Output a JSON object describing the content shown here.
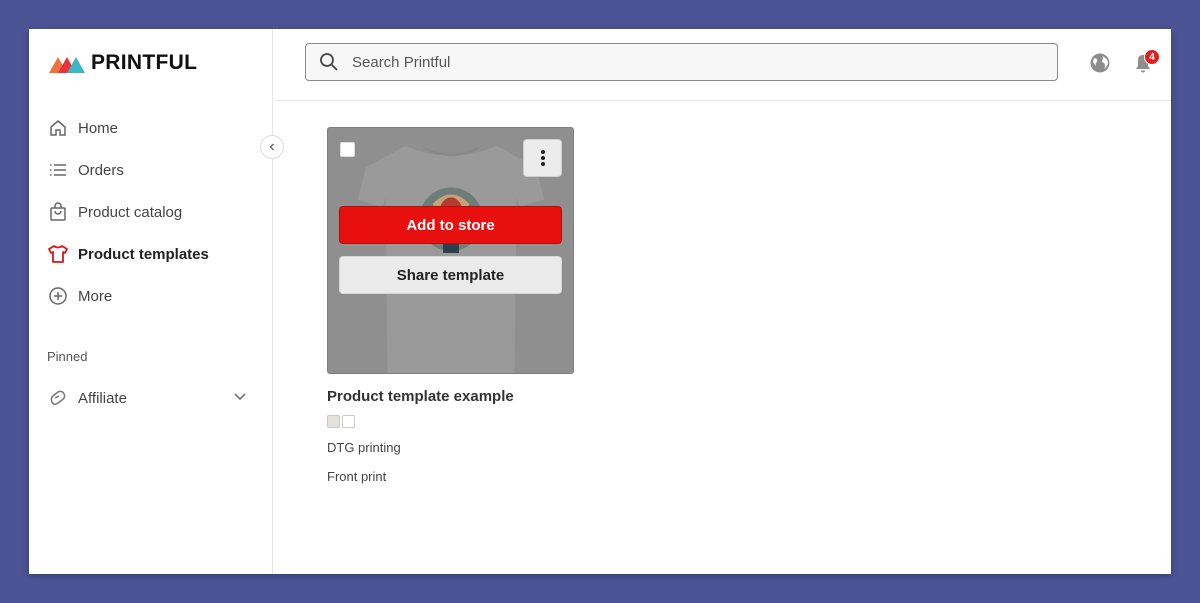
{
  "brand": {
    "name": "PRINTFUL",
    "colors": [
      "#f26f3e",
      "#e8333e",
      "#3bb7c4"
    ]
  },
  "sidebar": {
    "items": [
      {
        "label": "Home",
        "icon": "home-icon"
      },
      {
        "label": "Orders",
        "icon": "list-icon"
      },
      {
        "label": "Product catalog",
        "icon": "bag-icon"
      },
      {
        "label": "Product templates",
        "icon": "tshirt-icon",
        "active": true
      },
      {
        "label": "More",
        "icon": "plus-circle-icon"
      }
    ],
    "pinned_label": "Pinned",
    "pinned_items": [
      {
        "label": "Affiliate",
        "icon": "affiliate-icon"
      }
    ]
  },
  "header": {
    "search_placeholder": "Search Printful",
    "notification_count": "4"
  },
  "card": {
    "add_label": "Add to store",
    "share_label": "Share template",
    "title": "Product template example",
    "swatch_colors": [
      "#e4e2dc",
      "#ffffff"
    ],
    "technique": "DTG printing",
    "placement": "Front print"
  },
  "colors": {
    "accent": "#e8100f",
    "background": "#4a5494"
  }
}
